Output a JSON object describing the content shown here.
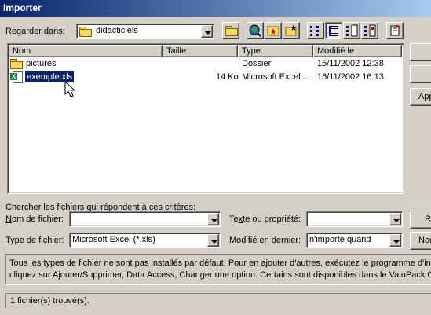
{
  "window": {
    "title": "Importer"
  },
  "look_in": {
    "label": "Regarder dans:",
    "value": "didacticiels"
  },
  "toolbar": {
    "buttons": [
      "up-folder-icon",
      "search-web-icon",
      "favorites-icon",
      "new-folder-icon",
      "list-view-icon",
      "details-view-icon",
      "properties-view-icon",
      "preview-view-icon",
      "tools-icon"
    ]
  },
  "file_list": {
    "columns": [
      "Nom",
      "Taille",
      "Type",
      "Modifié le"
    ],
    "rows": [
      {
        "name": "pictures",
        "size": "",
        "type": "Dossier",
        "modified": "15/11/2002 12:38",
        "icon": "folder-icon"
      },
      {
        "name": "exemple.xls",
        "size": "14 Ko",
        "type": "Microsoft Excel ...",
        "modified": "16/11/2002 16:13",
        "icon": "excel-file-icon",
        "selected": true
      }
    ]
  },
  "side_buttons": [
    "",
    "",
    "App"
  ],
  "search": {
    "heading": "Chercher les fichiers qui répondent à ces critères:",
    "filename_label": "Nom de fichier:",
    "filename_value": "",
    "filetype_label": "Type de fichier:",
    "filetype_value": "Microsoft Excel (*.xls)",
    "text_label": "Texte ou propriété:",
    "text_value": "",
    "modified_label": "Modifié en dernier:",
    "modified_value": "n'importe quand",
    "btn_search": "Re",
    "btn_new": "Nou"
  },
  "info": {
    "line1": "Tous les types de fichier ne sont pas installés par défaut. Pour en ajouter d'autres, exécutez le programme d'ins",
    "line2": "cliquez sur Ajouter/Supprimer, Data Access, Changer une option. Certains sont disponibles dans le ValuPack Offi"
  },
  "status": {
    "text": "1 fichier(s) trouvé(s)."
  },
  "colors": {
    "title_start": "#0a246a",
    "title_end": "#a6caf0",
    "selection": "#0a246a",
    "face": "#d4d0c8"
  }
}
